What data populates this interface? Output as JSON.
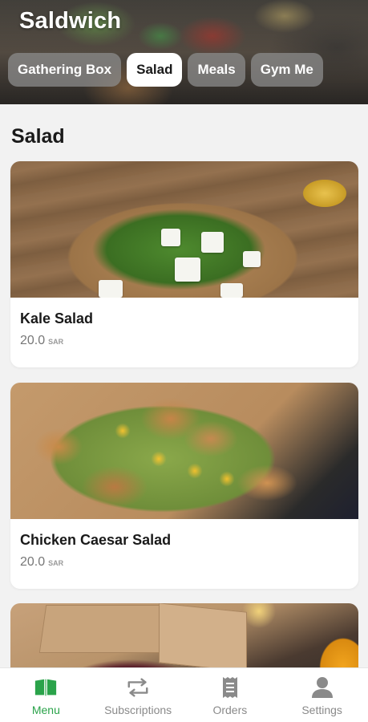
{
  "app": {
    "title": "Saldwich"
  },
  "tabs": [
    {
      "label": "Gathering Box",
      "active": false
    },
    {
      "label": "Salad",
      "active": true
    },
    {
      "label": "Meals",
      "active": false
    },
    {
      "label": "Gym Me",
      "active": false
    }
  ],
  "section": {
    "title": "Salad"
  },
  "items": [
    {
      "name": "Kale Salad",
      "price": "20.0",
      "currency": "SAR"
    },
    {
      "name": "Chicken Caesar Salad",
      "price": "20.0",
      "currency": "SAR"
    }
  ],
  "bottom_nav": [
    {
      "label": "Menu",
      "icon": "book-open-icon",
      "active": true
    },
    {
      "label": "Subscriptions",
      "icon": "repeat-icon",
      "active": false
    },
    {
      "label": "Orders",
      "icon": "receipt-icon",
      "active": false
    },
    {
      "label": "Settings",
      "icon": "person-icon",
      "active": false
    }
  ],
  "colors": {
    "accent": "#2aa34a",
    "inactive": "#8a8a8a",
    "background": "#f2f2f2"
  }
}
